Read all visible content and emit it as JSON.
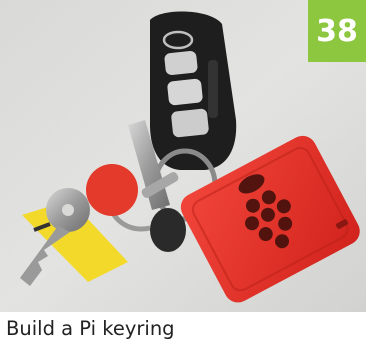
{
  "badge": {
    "number": "38",
    "color": "#8dc63f"
  },
  "caption": {
    "text": "Build a Pi keyring"
  },
  "photo": {
    "objects": [
      "car-key-fob",
      "red-pi-case",
      "house-keys",
      "keyring"
    ],
    "case_color": "#e8302a",
    "fob_color": "#1f1f1f"
  }
}
